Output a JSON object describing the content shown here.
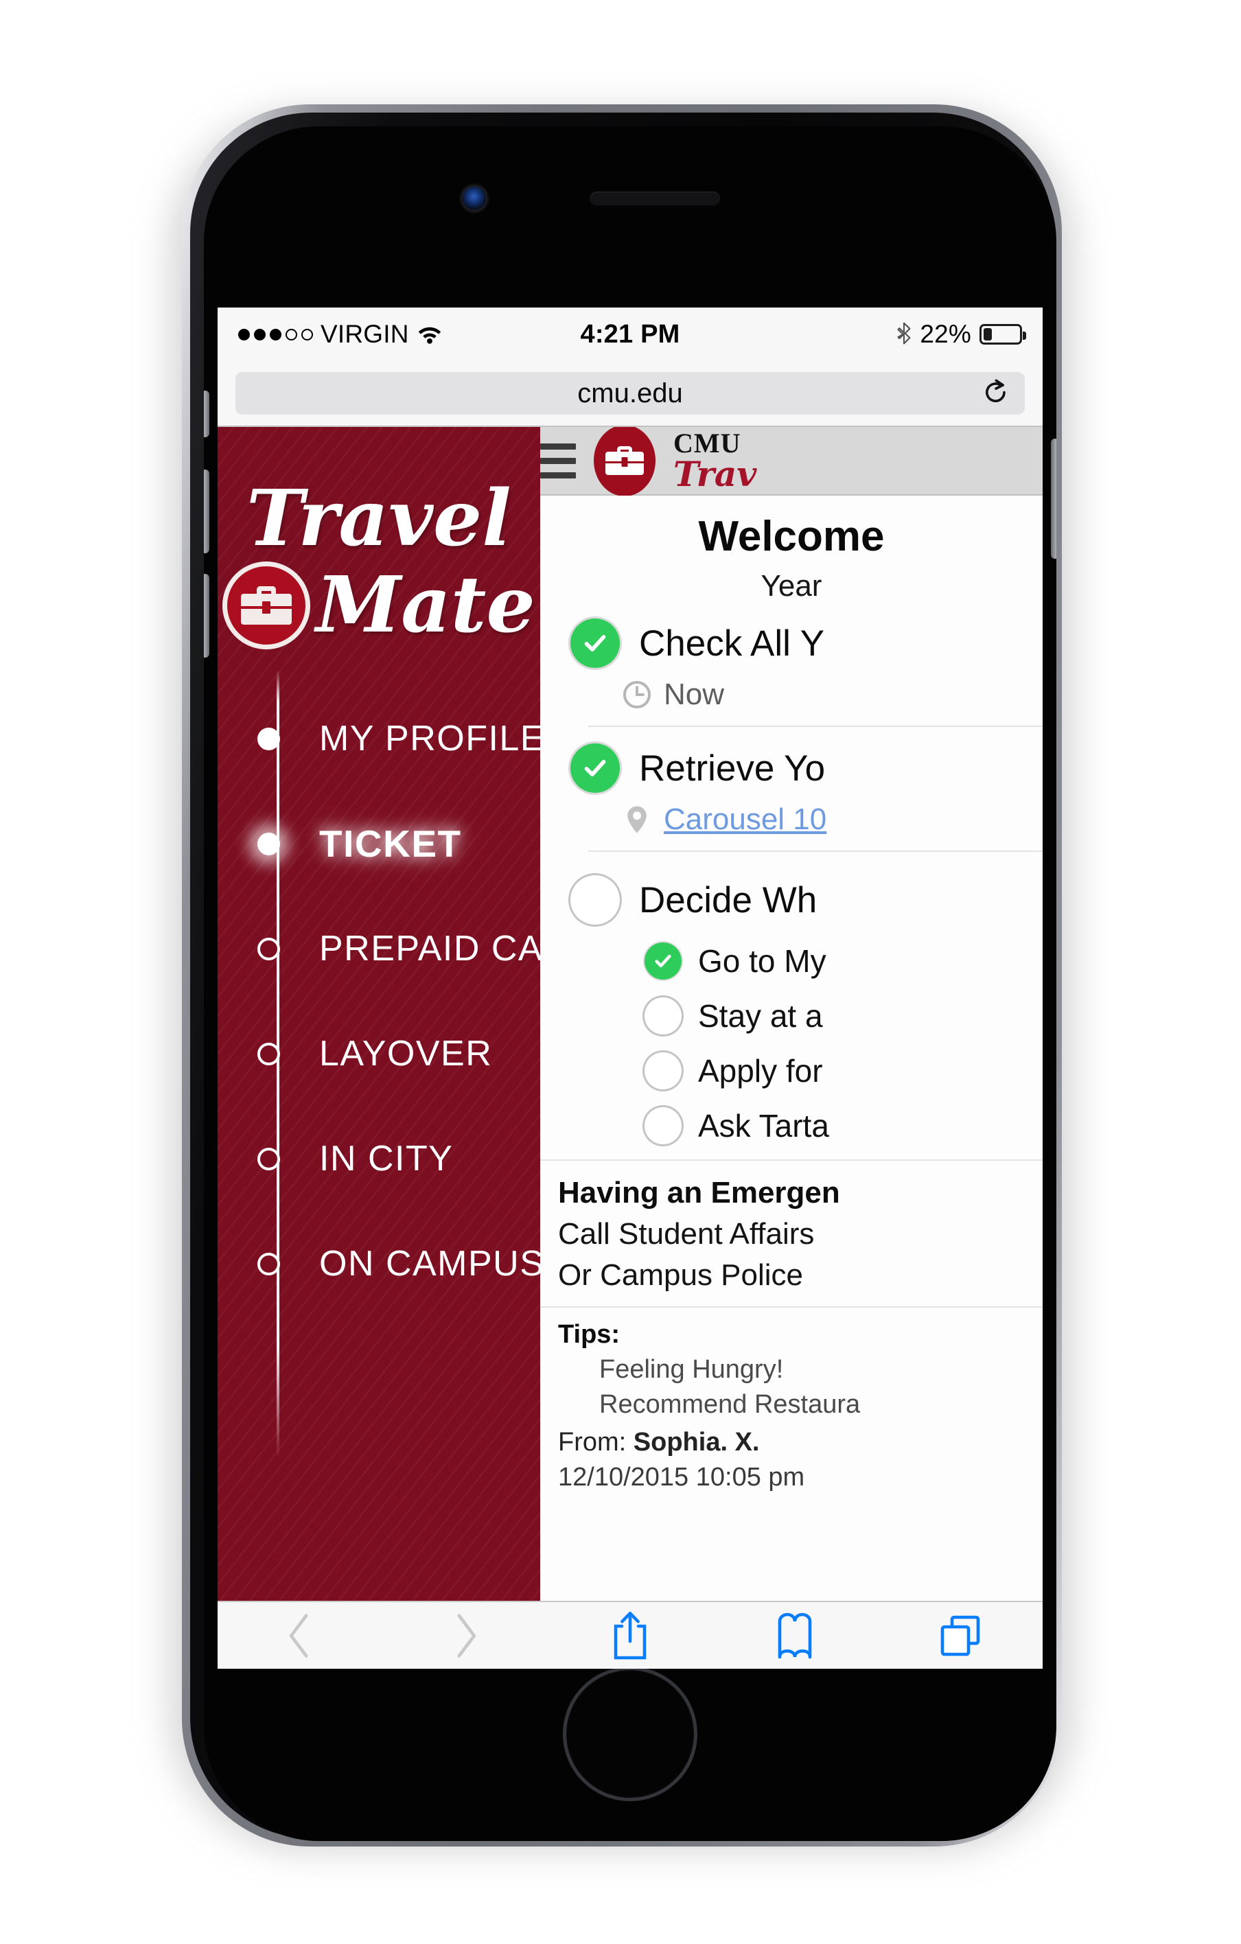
{
  "status_bar": {
    "signal_dots_total": 5,
    "signal_dots_filled": 3,
    "carrier": "VIRGIN",
    "wifi_icon": "wifi-icon",
    "time": "4:21 PM",
    "bluetooth_icon": "bluetooth-icon",
    "battery_percent": "22%",
    "battery_level": 22
  },
  "browser": {
    "url": "cmu.edu",
    "reload_icon": "reload-icon",
    "toolbar": {
      "back_icon": "back-chevron-icon",
      "forward_icon": "forward-chevron-icon",
      "share_icon": "share-icon",
      "bookmarks_icon": "bookmarks-icon",
      "tabs_icon": "tabs-icon"
    }
  },
  "app_header": {
    "menu_icon": "hamburger-menu-icon",
    "logo_icon": "briefcase-badge-icon",
    "brand_cmu": "CMU",
    "brand_travel": "Trav"
  },
  "drawer": {
    "logo_line1": "Travel",
    "logo_icon": "briefcase-badge-icon",
    "logo_line2": "Mate",
    "items": [
      {
        "label": "MY PROFILE",
        "state": "completed"
      },
      {
        "label": "TICKET",
        "state": "active"
      },
      {
        "label": "PREPAID CARD",
        "state": "pending"
      },
      {
        "label": "LAYOVER",
        "state": "pending"
      },
      {
        "label": "IN CITY",
        "state": "pending"
      },
      {
        "label": "ON CAMPUS",
        "state": "pending"
      }
    ]
  },
  "main": {
    "heading": "Welcome",
    "subheading": "Year",
    "tasks": [
      {
        "label": "Check All Y",
        "checked": true,
        "meta_icon": "clock-icon",
        "meta_text": "Now",
        "meta_is_link": false
      },
      {
        "label": "Retrieve Yo",
        "checked": true,
        "meta_icon": "location-pin-icon",
        "meta_text": "Carousel 10",
        "meta_is_link": true
      },
      {
        "label": "Decide Wh",
        "checked": false,
        "subitems": [
          {
            "label": "Go to My",
            "checked": true
          },
          {
            "label": "Stay at a",
            "checked": false
          },
          {
            "label": "Apply for",
            "checked": false
          },
          {
            "label": "Ask Tarta",
            "checked": false
          }
        ]
      }
    ],
    "emergency": {
      "title": "Having an Emergen",
      "lines": [
        "Call Student Affairs",
        "Or Campus Police"
      ]
    },
    "tips": {
      "title": "Tips:",
      "lines": [
        "Feeling Hungry!",
        "Recommend Restaura"
      ],
      "from_label": "From: ",
      "from_name": "Sophia. X.",
      "timestamp": "12/10/2015  10:05 pm"
    }
  },
  "colors": {
    "brand_red": "#7B0E20",
    "logo_red": "#9D0D1E",
    "check_green": "#2ECC5A",
    "link_blue": "#6E9AE0",
    "safari_blue": "#0a7dfa"
  }
}
